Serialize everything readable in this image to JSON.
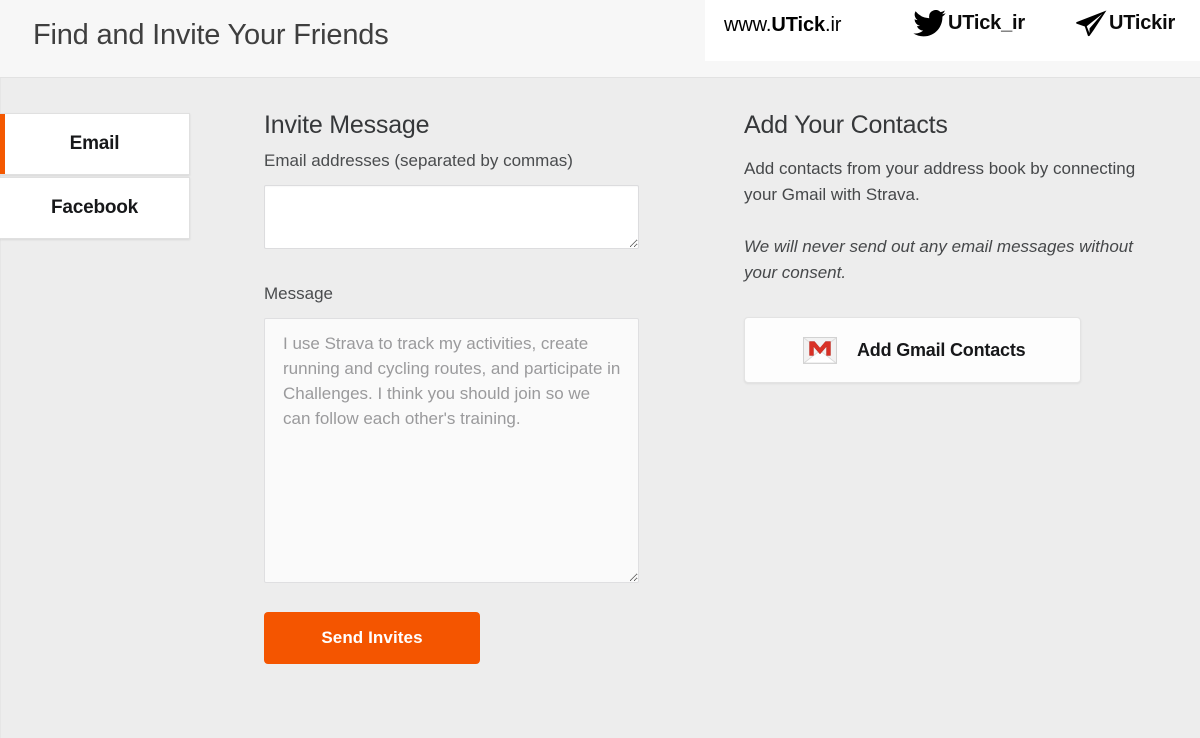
{
  "header": {
    "title": "Find and Invite Your Friends",
    "brand": {
      "site_prefix": "www.",
      "site_name": "UTick",
      "site_tld": ".ir",
      "twitter_handle": "UTick_ir",
      "twitter_icon": "twitter-bird-icon",
      "telegram_handle": "UTickir",
      "telegram_icon": "telegram-plane-icon"
    }
  },
  "tabs": [
    {
      "label": "Email",
      "active": true
    },
    {
      "label": "Facebook",
      "active": false
    }
  ],
  "invite": {
    "section_title": "Invite Message",
    "emails_label": "Email addresses (separated by commas)",
    "emails_value": "",
    "emails_placeholder": "",
    "message_label": "Message",
    "message_value": "",
    "message_placeholder": "I use Strava to track my activities, create running and cycling routes, and participate in Challenges. I think you should join so we can follow each other's training.",
    "send_label": "Send Invites",
    "send_color": "#f45500"
  },
  "contacts": {
    "section_title": "Add Your Contacts",
    "description": "Add contacts from your address book by connecting your Gmail with Strava.",
    "disclaimer": "We will never send out any email messages without your consent.",
    "gmail_button_label": "Add Gmail Contacts",
    "gmail_icon": "gmail-envelope-icon"
  },
  "colors": {
    "accent": "#f45500",
    "tab_active_bar": "#f45800",
    "page_background": "#ededed",
    "header_background": "#f7f7f7"
  }
}
